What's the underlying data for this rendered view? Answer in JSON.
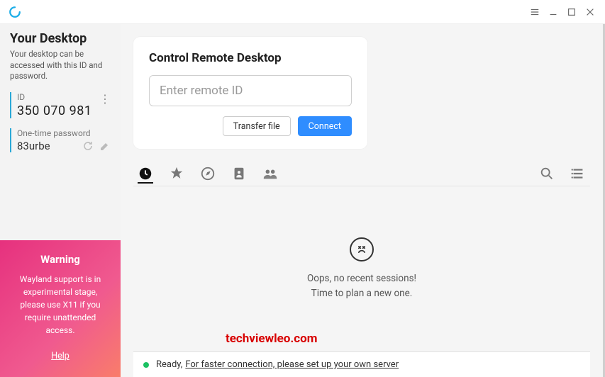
{
  "titlebar": {
    "logo_color": "#1daee8"
  },
  "sidebar": {
    "title": "Your Desktop",
    "desc": "Your desktop can be accessed with this ID and password.",
    "id_label": "ID",
    "id_value": "350 070 981",
    "pw_label": "One-time password",
    "pw_value": "83urbe"
  },
  "warning": {
    "title": "Warning",
    "text": "Wayland support is in experimental stage, please use X11 if you require unattended access.",
    "help": "Help"
  },
  "control": {
    "title": "Control Remote Desktop",
    "placeholder": "Enter remote ID",
    "transfer": "Transfer file",
    "connect": "Connect"
  },
  "empty": {
    "line1": "Oops, no recent sessions!",
    "line2": "Time to plan a new one."
  },
  "status": {
    "ready": "Ready,",
    "link": "For faster connection, please set up your own server"
  },
  "watermark": "techviewleo.com"
}
